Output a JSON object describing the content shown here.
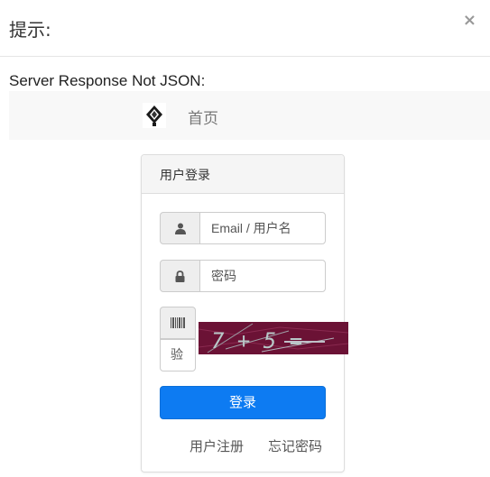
{
  "dialog": {
    "title": "提示:",
    "close_label": "×"
  },
  "error": {
    "message": "Server Response Not JSON:"
  },
  "navbar": {
    "home_label": "首页"
  },
  "login_panel": {
    "heading": "用户登录",
    "username_placeholder": "Email / 用户名",
    "password_placeholder": "密码",
    "captcha_placeholder": "验",
    "captcha_text": "7 + 5 =",
    "submit_label": "登录",
    "register_link": "用户注册",
    "forgot_link": "忘记密码"
  },
  "icons": {
    "user": "user-icon",
    "lock": "lock-icon",
    "barcode": "barcode-icon",
    "logo": "site-logo"
  },
  "colors": {
    "primary_button": "#0d7bf2",
    "captcha_background": "#6b1235",
    "navbar_background": "#f8f8f8",
    "panel_heading_background": "#f5f5f5"
  }
}
